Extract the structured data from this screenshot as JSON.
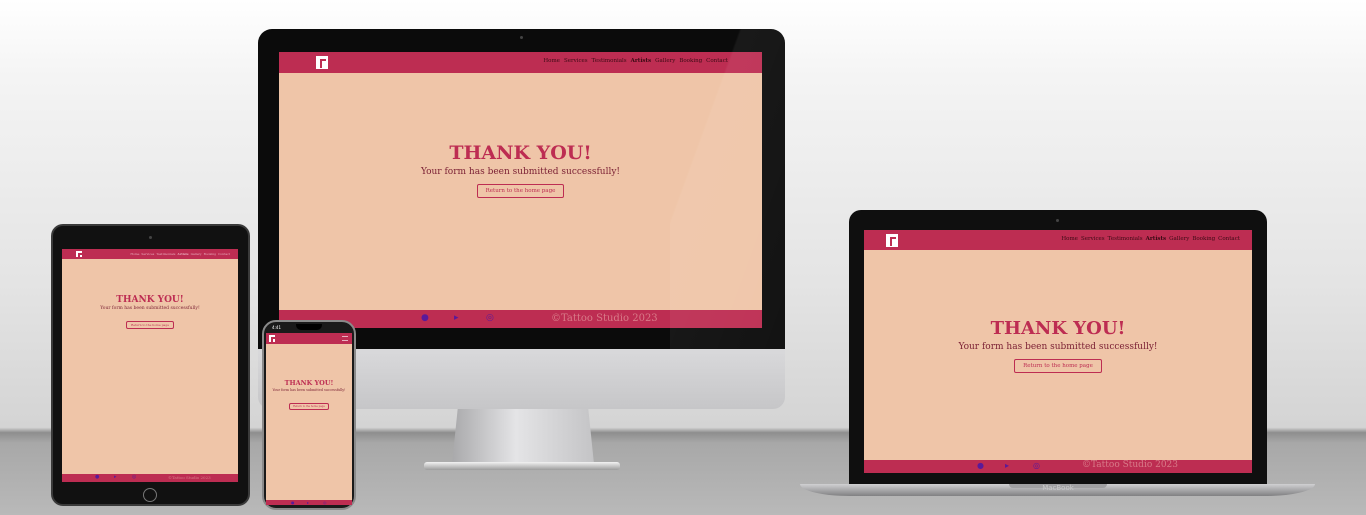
{
  "site": {
    "nav_links": [
      "Home",
      "Services",
      "Testimonials",
      "Artists",
      "Gallery",
      "Booking",
      "Contact"
    ],
    "active_link": "Artists",
    "thank_title": "THANK YOU!",
    "message": "Your form has been submitted successfully!",
    "return_button": "Return to the home page",
    "copyright": "©Tattoo Studio 2023",
    "social_icons": [
      "facebook-icon",
      "twitter-icon",
      "instagram-icon"
    ]
  },
  "devices": {
    "laptop_label": "MacBook",
    "phone_time": "4:41"
  },
  "colors": {
    "nav": "#bd2d52",
    "background": "#efc5a8",
    "accent": "#bd2d52"
  }
}
